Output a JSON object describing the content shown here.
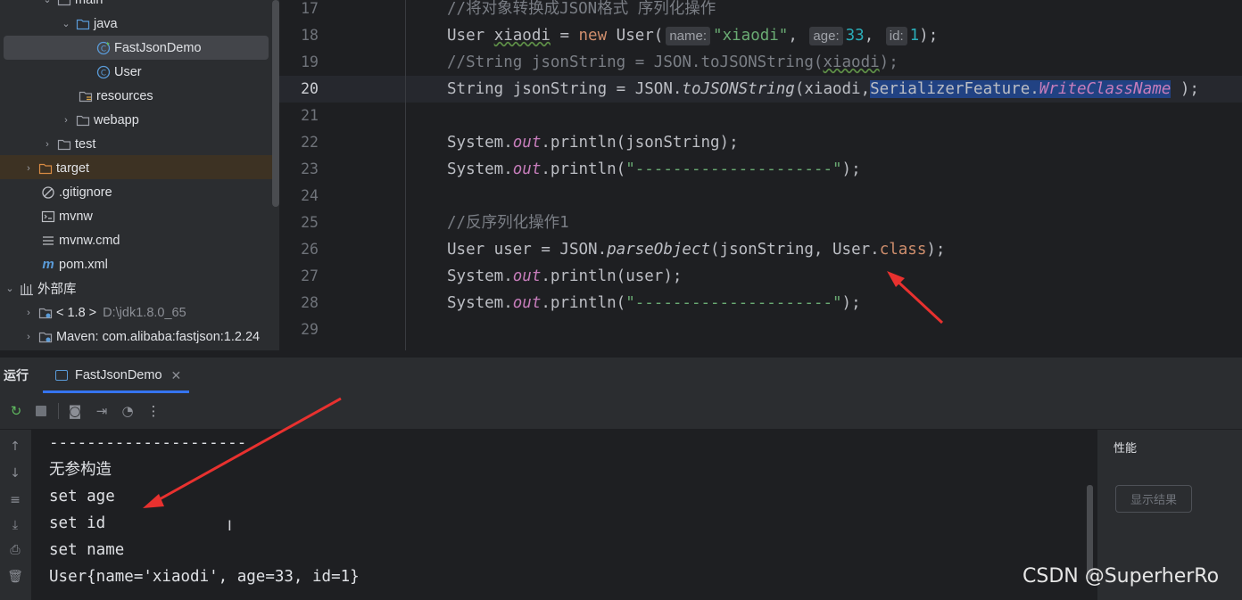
{
  "tree": {
    "items": [
      {
        "label": "main",
        "icon": "folder-icon",
        "arrow": "expanded"
      },
      {
        "label": "java",
        "icon": "folder-icon",
        "arrow": "expanded"
      },
      {
        "label": "FastJsonDemo",
        "icon": "java-class-runnable-icon",
        "selected": true
      },
      {
        "label": "User",
        "icon": "java-class-icon"
      },
      {
        "label": "resources",
        "icon": "resources-folder-icon"
      },
      {
        "label": "webapp",
        "icon": "folder-icon",
        "arrow": "collapsed"
      },
      {
        "label": "test",
        "icon": "folder-icon",
        "arrow": "collapsed"
      },
      {
        "label": "target",
        "icon": "excluded-folder-icon",
        "arrow": "collapsed"
      },
      {
        "label": ".gitignore",
        "icon": "ignore-file-icon"
      },
      {
        "label": "mvnw",
        "icon": "terminal-file-icon"
      },
      {
        "label": "mvnw.cmd",
        "icon": "text-file-icon"
      },
      {
        "label": "pom.xml",
        "icon": "maven-icon"
      },
      {
        "label": "外部库",
        "icon": "library-icon",
        "arrow": "expanded"
      },
      {
        "label": "< 1.8 >",
        "dim": "D:\\jdk1.8.0_65",
        "icon": "jdk-folder-icon",
        "arrow": "collapsed"
      },
      {
        "label": "Maven: com.alibaba:fastjson:1.2.24",
        "icon": "library-folder-icon",
        "arrow": "collapsed"
      }
    ]
  },
  "editor": {
    "line_numbers": [
      "17",
      "18",
      "19",
      "20",
      "21",
      "22",
      "23",
      "24",
      "25",
      "26",
      "27",
      "28",
      "29"
    ],
    "current_line": "20",
    "lines": {
      "l17": {
        "c": "//将对象转换成JSON格式 序列化操作"
      },
      "l18": {
        "a": "User ",
        "b": "xiaodi",
        "c": " = ",
        "d": "new",
        "e": " User(",
        "h1": "name:",
        "s": "\"xiaodi\"",
        "f": ", ",
        "h2": "age:",
        "n1": "33",
        "g": ", ",
        "h3": "id:",
        "n2": "1",
        "z": ");"
      },
      "l19": {
        "c": "//String jsonString = JSON.toJSONString(",
        "d": "xiaodi",
        "e": ");"
      },
      "l20": {
        "a": "String jsonString = JSON.",
        "b": "toJSONString",
        "c": "(xiaodi,",
        "d": "SerializerFeature.",
        "e": "WriteClassName",
        "f": " );"
      },
      "l22": {
        "a": "System.",
        "b": "out",
        "c": ".println(jsonString);"
      },
      "l23": {
        "a": "System.",
        "b": "out",
        "c": ".println(",
        "s": "\"---------------------\"",
        "z": ");"
      },
      "l25": {
        "c": "//反序列化操作1"
      },
      "l26": {
        "a": "User user = JSON.",
        "b": "parseObject",
        "c": "(jsonString, User.",
        "d": "class",
        "e": ");"
      },
      "l27": {
        "a": "System.",
        "b": "out",
        "c": ".println(user);"
      },
      "l28": {
        "a": "System.",
        "b": "out",
        "c": ".println(",
        "s": "\"---------------------\"",
        "z": ");"
      }
    }
  },
  "run_panel": {
    "label": "运行",
    "tab_label": "FastJsonDemo",
    "toolbar": [
      "rerun-icon",
      "stop-icon",
      "screenshot-icon",
      "exit-icon",
      "profiler-icon",
      "more-icon"
    ],
    "output": [
      "---------------------",
      "无参构造",
      "set age",
      "set id",
      "set name",
      "User{name='xiaodi', age=33, id=1}"
    ]
  },
  "perf": {
    "title": "性能",
    "button": "显示结果"
  },
  "watermark": "CSDN @SuperherRo",
  "colors": {
    "accent": "#3574f0",
    "annotation_arrow": "#e8312f",
    "selection": "#214283"
  }
}
